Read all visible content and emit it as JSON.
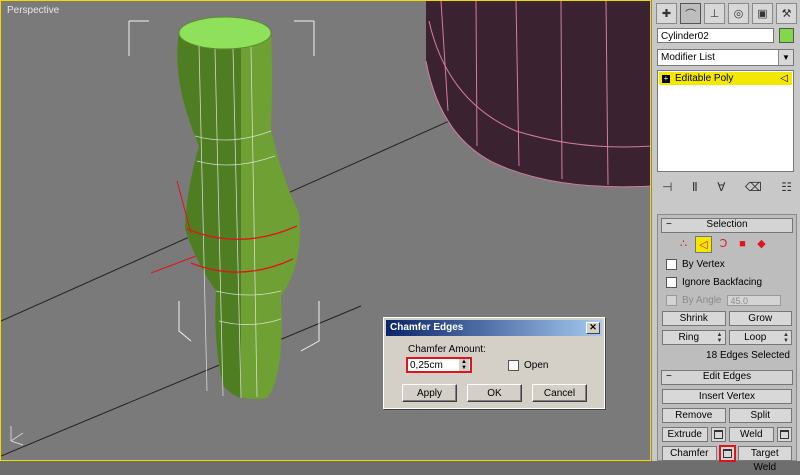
{
  "viewport": {
    "label": "Perspective"
  },
  "command_panel": {
    "tabs": [
      "create-icon",
      "modify-icon",
      "hierarchy-icon",
      "motion-icon",
      "display-icon",
      "utilities-icon"
    ],
    "object_name": "Cylinder02",
    "object_color": "#82d84b",
    "modifier_list_label": "Modifier List",
    "stack_item": "Editable Poly",
    "stack_tools": [
      "pin-stack-icon",
      "show-end-result-icon",
      "make-unique-icon",
      "remove-modifier-icon",
      "configure-sets-icon"
    ]
  },
  "selection": {
    "title": "Selection",
    "minus": "−",
    "by_vertex": "By Vertex",
    "ignore_backfacing": "Ignore Backfacing",
    "by_angle": "By Angle",
    "angle_value": "45.0",
    "shrink": "Shrink",
    "grow": "Grow",
    "ring": "Ring",
    "loop": "Loop",
    "status": "18 Edges Selected"
  },
  "edit_edges": {
    "title": "Edit Edges",
    "minus": "−",
    "insert_vertex": "Insert Vertex",
    "remove": "Remove",
    "split": "Split",
    "extrude": "Extrude",
    "weld": "Weld",
    "chamfer": "Chamfer",
    "target_weld": "Target Weld"
  },
  "chamfer_dialog": {
    "title": "Chamfer Edges",
    "close": "✕",
    "amount_label": "Chamfer Amount:",
    "amount_value": "0,25cm",
    "open_label": "Open",
    "apply": "Apply",
    "ok": "OK",
    "cancel": "Cancel"
  }
}
